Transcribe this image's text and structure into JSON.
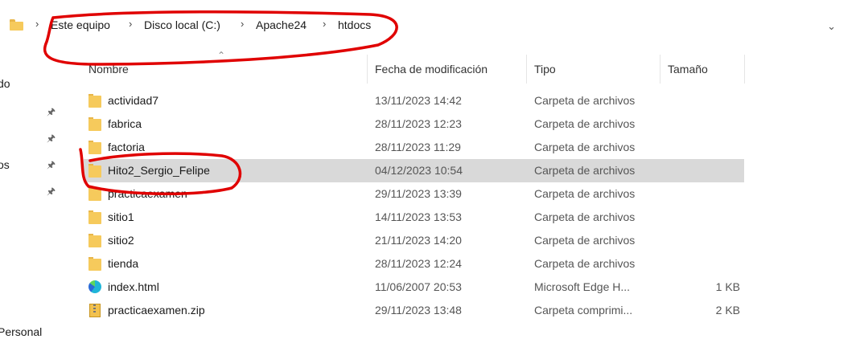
{
  "breadcrumb": {
    "items": [
      "Este equipo",
      "Disco local (C:)",
      "Apache24",
      "htdocs"
    ],
    "separator": "›",
    "dropdown_icon": "chevron-down-icon"
  },
  "nav_pane": {
    "fragments": [
      "do",
      "os",
      "Personal"
    ],
    "pin_icon": "pin-icon"
  },
  "columns": {
    "name": "Nombre",
    "modified": "Fecha de modificación",
    "type": "Tipo",
    "size": "Tamaño"
  },
  "files": [
    {
      "name": "actividad7",
      "modified": "13/11/2023 14:42",
      "type": "Carpeta de archivos",
      "size": "",
      "icon": "folder-icon"
    },
    {
      "name": "fabrica",
      "modified": "28/11/2023 12:23",
      "type": "Carpeta de archivos",
      "size": "",
      "icon": "folder-icon"
    },
    {
      "name": "factoria",
      "modified": "28/11/2023 11:29",
      "type": "Carpeta de archivos",
      "size": "",
      "icon": "folder-icon"
    },
    {
      "name": "Hito2_Sergio_Felipe",
      "modified": "04/12/2023 10:54",
      "type": "Carpeta de archivos",
      "size": "",
      "icon": "folder-icon",
      "selected": true
    },
    {
      "name": "practicaexamen",
      "modified": "29/11/2023 13:39",
      "type": "Carpeta de archivos",
      "size": "",
      "icon": "folder-icon"
    },
    {
      "name": "sitio1",
      "modified": "14/11/2023 13:53",
      "type": "Carpeta de archivos",
      "size": "",
      "icon": "folder-icon"
    },
    {
      "name": "sitio2",
      "modified": "21/11/2023 14:20",
      "type": "Carpeta de archivos",
      "size": "",
      "icon": "folder-icon"
    },
    {
      "name": "tienda",
      "modified": "28/11/2023 12:24",
      "type": "Carpeta de archivos",
      "size": "",
      "icon": "folder-icon"
    },
    {
      "name": "index.html",
      "modified": "11/06/2007 20:53",
      "type": "Microsoft Edge H...",
      "size": "1 KB",
      "icon": "edge-icon"
    },
    {
      "name": "practicaexamen.zip",
      "modified": "29/11/2023 13:48",
      "type": "Carpeta comprimi...",
      "size": "2 KB",
      "icon": "zip-icon"
    }
  ],
  "colors": {
    "selection": "#d9d9d9",
    "annotation": "#e00000",
    "folder": "#f6ca5c"
  }
}
